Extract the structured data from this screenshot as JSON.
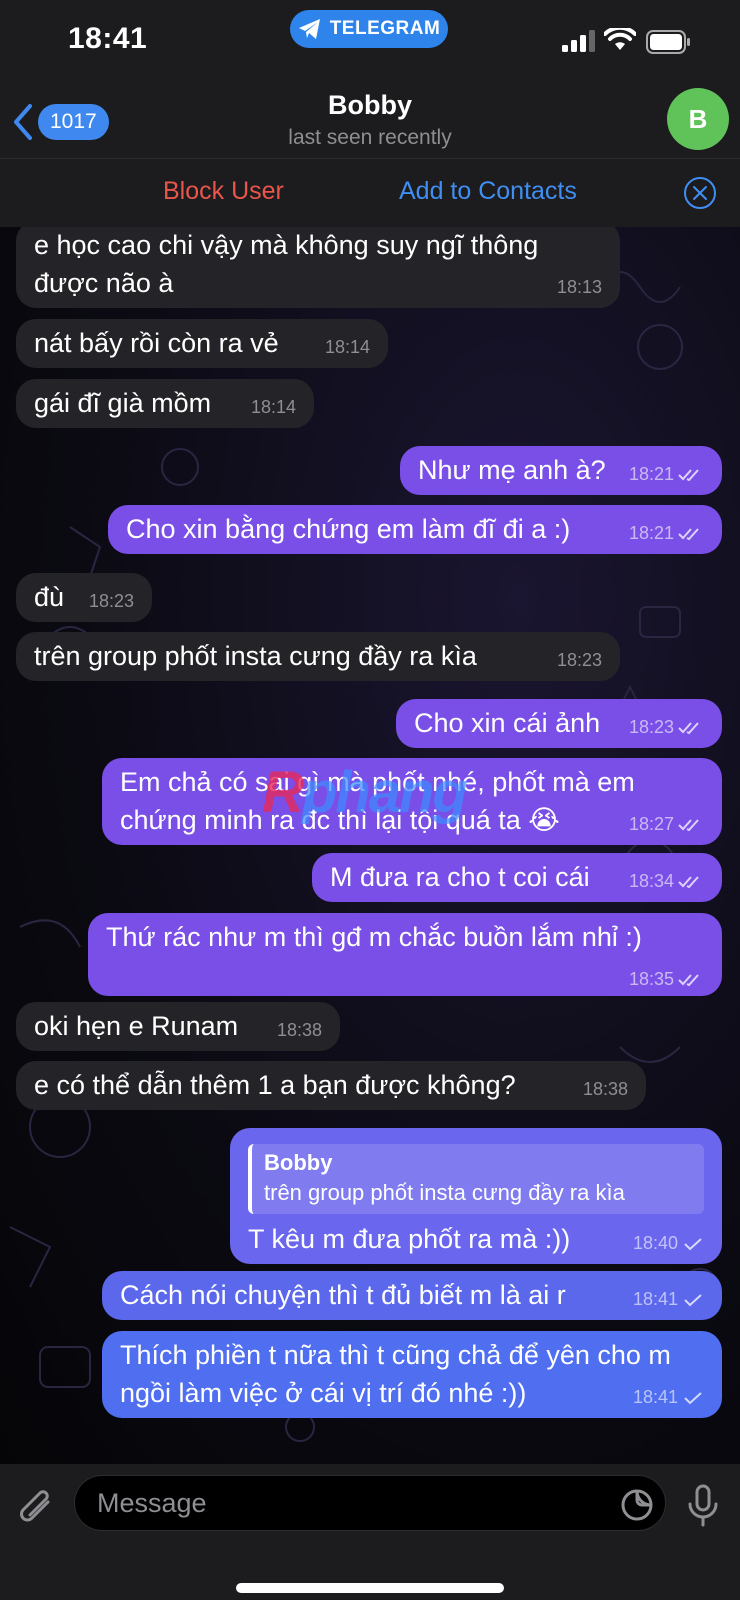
{
  "status_bar": {
    "time": "18:41",
    "app_name": "TELEGRAM"
  },
  "header": {
    "back_count": "1017",
    "title": "Bobby",
    "subtitle": "last seen recently",
    "avatar_letter": "B",
    "avatar_color": "#5fc35a"
  },
  "actions": {
    "block": "Block User",
    "add": "Add to Contacts"
  },
  "colors": {
    "outgoing": "#7a4fe7",
    "incoming": "#242428",
    "accent": "#3f8ef0",
    "danger": "#e9554a"
  },
  "messages": [
    {
      "dir": "in",
      "text": "e học cao chi vậy mà không suy ngĩ thông được não à",
      "time": "18:13"
    },
    {
      "dir": "in",
      "text": "nát bấy rồi còn ra vẻ",
      "time": "18:14"
    },
    {
      "dir": "in",
      "text": "gái đĩ già mồm",
      "time": "18:14"
    },
    {
      "dir": "out",
      "text": "Như mẹ anh à?",
      "time": "18:21"
    },
    {
      "dir": "out",
      "text": "Cho xin bằng chứng em làm đĩ đi a :)",
      "time": "18:21"
    },
    {
      "dir": "in",
      "text": "đù",
      "time": "18:23"
    },
    {
      "dir": "in",
      "text": "trên group phốt insta cưng đầy ra kìa",
      "time": "18:23"
    },
    {
      "dir": "out",
      "text": "Cho xin cái ảnh",
      "time": "18:23"
    },
    {
      "dir": "out",
      "text": "Em chả có sai gì mà phốt nhé, phốt mà em chứng minh ra đc thì lại tội quá ta 😭",
      "time": "18:27"
    },
    {
      "dir": "out",
      "text": "M đưa ra cho t coi cái",
      "time": "18:34"
    },
    {
      "dir": "out",
      "text": "Thứ rác như m thì gđ m chắc buồn lắm nhỉ :)",
      "time": "18:35"
    },
    {
      "dir": "in",
      "text": "oki hẹn e Runam",
      "time": "18:38"
    },
    {
      "dir": "in",
      "text": "e có thể dẫn thêm 1 a bạn được không?",
      "time": "18:38"
    },
    {
      "dir": "out",
      "reply_name": "Bobby",
      "reply_text": "trên group phốt insta cưng đầy ra kìa",
      "text": "T kêu m đưa phốt ra mà :))",
      "time": "18:40"
    },
    {
      "dir": "out",
      "text": "Cách nói chuyện thì t đủ biết m là ai r",
      "time": "18:41"
    },
    {
      "dir": "out",
      "text": "Thích phiền t nữa thì t cũng chả để yên cho m ngồi làm việc ở cái vị trí đó nhé :))",
      "time": "18:41"
    }
  ],
  "watermark": {
    "part1": "R",
    "part2": "phang"
  },
  "input": {
    "placeholder": "Message"
  }
}
